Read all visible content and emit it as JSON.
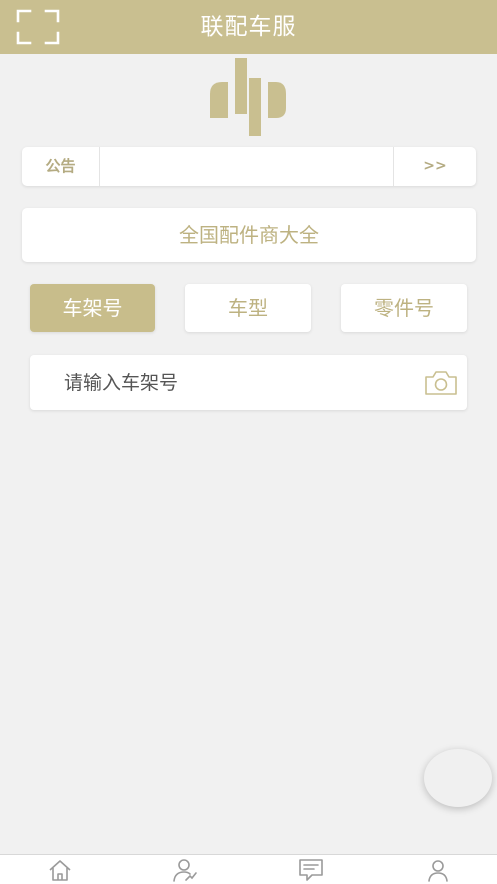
{
  "header": {
    "title": "联配车服",
    "scan_icon": "scan-frame-icon"
  },
  "logo": {
    "icon": "brand-logo-icon"
  },
  "notice": {
    "label": "公告",
    "content": "",
    "more_label": ">>"
  },
  "directory_button": {
    "label": "全国配件商大全"
  },
  "search_tabs": [
    {
      "label": "车架号",
      "active": true
    },
    {
      "label": "车型",
      "active": false
    },
    {
      "label": "零件号",
      "active": false
    }
  ],
  "search": {
    "placeholder": "请输入车架号",
    "value": "",
    "camera_icon": "camera-icon"
  },
  "bottom_nav": {
    "items": [
      {
        "icon": "home-icon"
      },
      {
        "icon": "user-stats-icon"
      },
      {
        "icon": "notes-icon"
      },
      {
        "icon": "profile-icon"
      }
    ]
  },
  "colors": {
    "accent": "#c9bf90",
    "accent_text": "#bdb281",
    "background": "#f1f1f1",
    "card": "#ffffff"
  }
}
